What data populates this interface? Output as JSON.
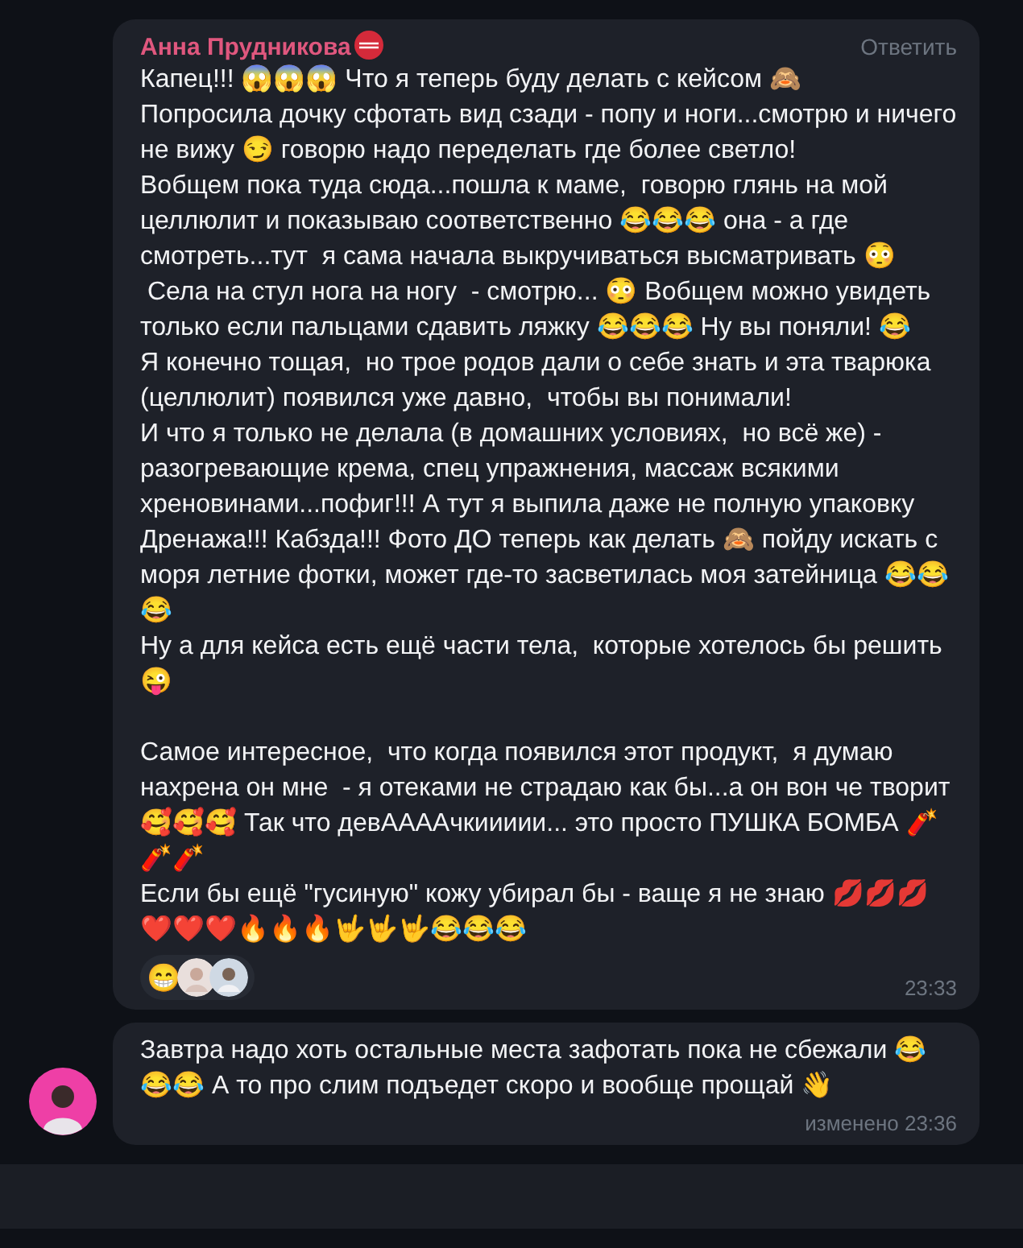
{
  "messages": [
    {
      "author": "Анна Прудникова",
      "reply_action": "Ответить",
      "text": "Капец!!! 😱😱😱 Что я теперь буду делать с кейсом 🙈\nПопросила дочку сфотать вид сзади - попу и ноги...смотрю и ничего не вижу 😏 говорю надо переделать где более светло!\nВобщем пока туда сюда...пошла к маме,  говорю глянь на мой целлюлит и показываю соответственно 😂😂😂 она - а где смотреть...тут  я сама начала выкручиваться высматривать 😳\n Села на стул нога на ногу  - смотрю... 😳 Вобщем можно увидеть только если пальцами сдавить ляжку 😂😂😂 Ну вы поняли! 😂\nЯ конечно тощая,  но трое родов дали о себе знать и эта тварюка (целлюлит) появился уже давно,  чтобы вы понимали!\nИ что я только не делала (в домашних условиях,  но всё же) - разогревающие крема, спец упражнения, массаж всякими хреновинами...пофиг!!! А тут я выпила даже не полную упаковку Дренажа!!! Кабзда!!! Фото ДО теперь как делать 🙈 пойду искать с моря летние фотки, может где-то засветилась моя затейница 😂😂😂\nНу а для кейса есть ещё части тела,  которые хотелось бы решить 😜\n\nСамое интересное,  что когда появился этот продукт,  я думаю нахрена он мне  - я отеками не страдаю как бы...а он вон че творит 🥰🥰🥰 Так что девААААчкиииии... это просто ПУШКА БОМБА 🧨🧨🧨\nЕсли бы ещё \"гусиную\" кожу убирал бы - ваще я не знаю 💋💋💋❤️❤️❤️🔥🔥🔥🤟🤟🤟😂😂😂",
      "reaction": "😁",
      "time": "23:33",
      "show_avatar": false
    },
    {
      "text": "Завтра надо хоть остальные места зафотать пока не сбежали 😂😂😂 А то про слим подъедет скоро и вообще прощай 👋",
      "time": "изменено 23:36",
      "show_avatar": true
    }
  ]
}
